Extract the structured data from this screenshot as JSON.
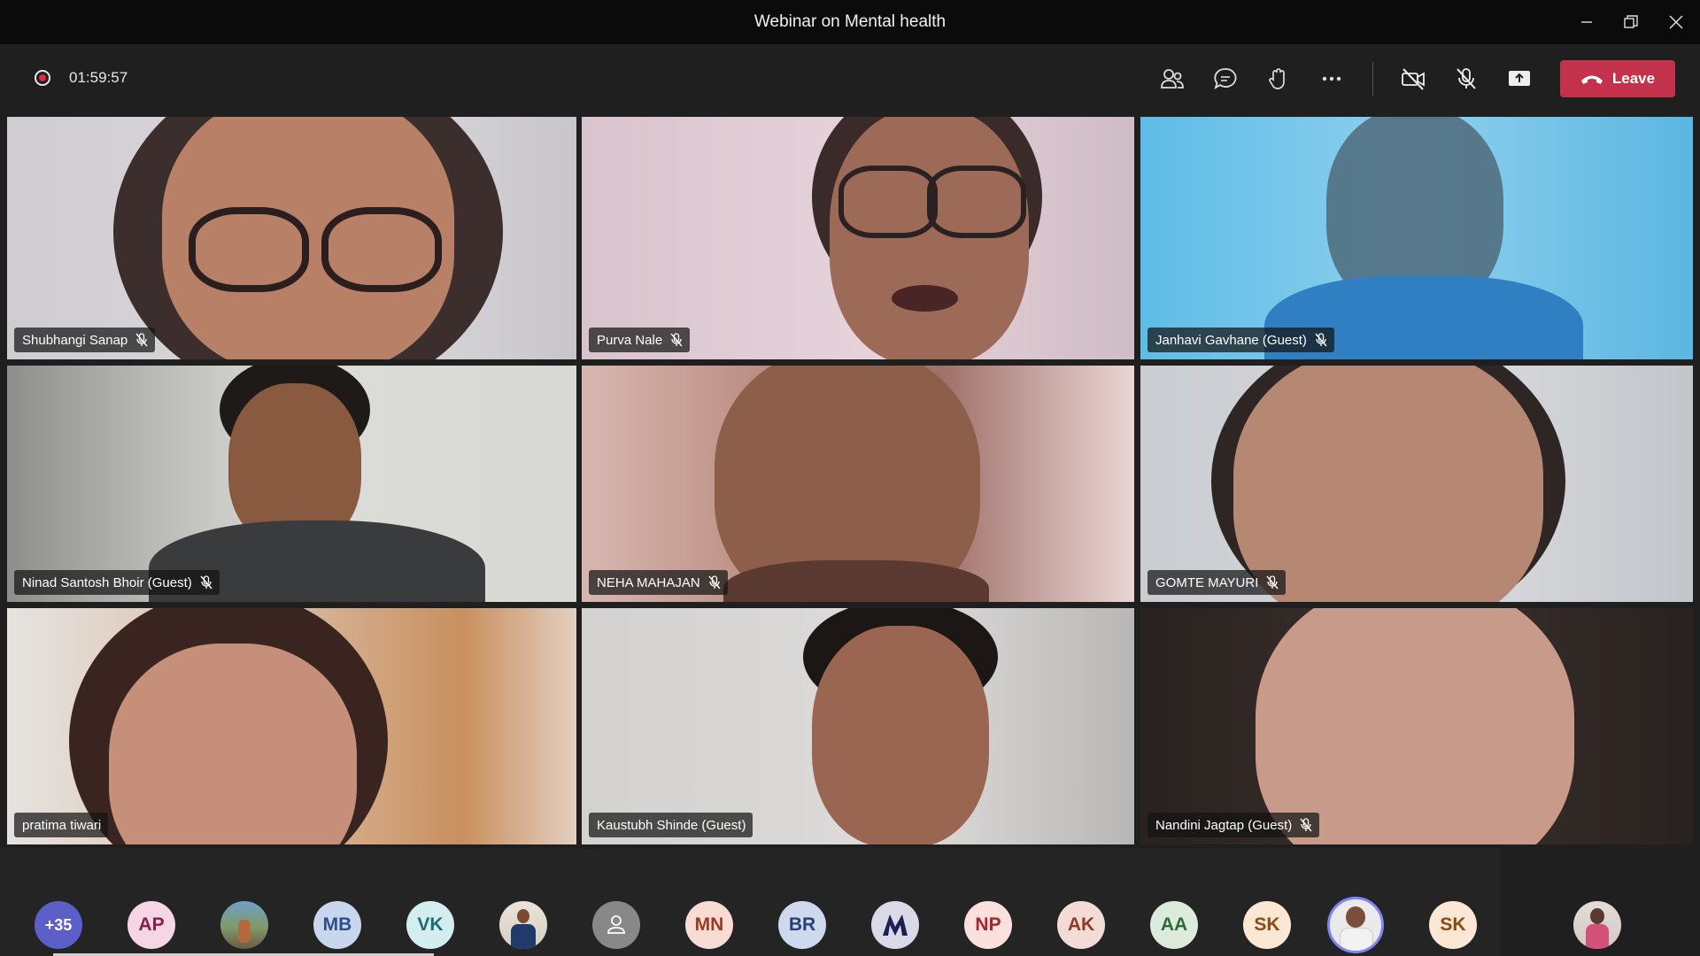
{
  "window": {
    "title": "Webinar on Mental health"
  },
  "toolbar": {
    "timer": "01:59:57",
    "leave_label": "Leave",
    "icons": [
      "people-icon",
      "chat-icon",
      "raise-hand-icon",
      "more-icon",
      "camera-off-icon",
      "mic-off-icon",
      "share-screen-icon",
      "phone-hangup-icon"
    ]
  },
  "colors": {
    "leave_button": "#c4314b",
    "recording": "#e0283a",
    "speaking_ring": "#7f85f5",
    "overflow_badge": "#5b5fc7"
  },
  "participants": [
    {
      "name": "Shubhangi Sanap",
      "muted": true
    },
    {
      "name": "Purva Nale",
      "muted": true
    },
    {
      "name": "Janhavi Gavhane (Guest)",
      "muted": true
    },
    {
      "name": "Ninad Santosh Bhoir (Guest)",
      "muted": true
    },
    {
      "name": "NEHA MAHAJAN",
      "muted": true
    },
    {
      "name": "GOMTE MAYURI",
      "muted": true
    },
    {
      "name": "pratima tiwari",
      "muted": false
    },
    {
      "name": "Kaustubh Shinde (Guest)",
      "muted": false
    },
    {
      "name": "Nandini Jagtap (Guest)",
      "muted": true
    }
  ],
  "strip": {
    "overflow": "+35",
    "avatars": [
      {
        "initials": "AP",
        "kind": "initials"
      },
      {
        "initials": "",
        "kind": "photo"
      },
      {
        "initials": "MB",
        "kind": "initials"
      },
      {
        "initials": "VK",
        "kind": "initials"
      },
      {
        "initials": "",
        "kind": "photo"
      },
      {
        "initials": "",
        "kind": "default"
      },
      {
        "initials": "MN",
        "kind": "initials"
      },
      {
        "initials": "BR",
        "kind": "initials"
      },
      {
        "initials": "",
        "kind": "logo"
      },
      {
        "initials": "NP",
        "kind": "initials"
      },
      {
        "initials": "AK",
        "kind": "initials"
      },
      {
        "initials": "AA",
        "kind": "initials"
      },
      {
        "initials": "SK",
        "kind": "initials"
      },
      {
        "initials": "",
        "kind": "photo-speaking"
      },
      {
        "initials": "SK",
        "kind": "initials"
      },
      {
        "initials": "",
        "kind": "photo-self"
      }
    ]
  }
}
